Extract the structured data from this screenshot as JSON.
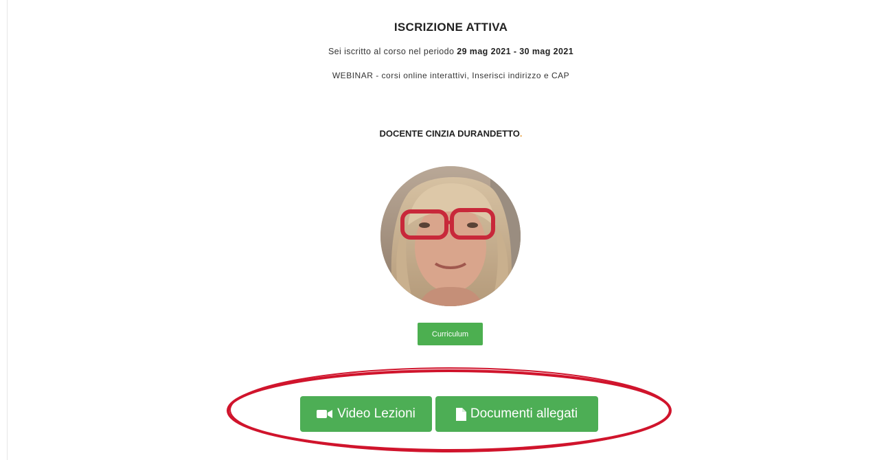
{
  "enrollment": {
    "title": "ISCRIZIONE ATTIVA",
    "period_prefix": "Sei iscritto al corso nel periodo",
    "period_range": "29 mag 2021 - 30 mag 2021",
    "course_type": "WEBINAR - corsi online interattivi, Inserisci indirizzo e CAP"
  },
  "teacher": {
    "label": "DOCENTE CINZIA DURANDETTO",
    "trailing_dot": ".",
    "photo_icon": "teacher-avatar"
  },
  "buttons": {
    "curriculum": "Curriculum",
    "video_lessons": "Video Lezioni",
    "documents": "Documenti allegati"
  },
  "icons": {
    "video": "video-camera-icon",
    "document": "document-file-icon"
  },
  "colors": {
    "button_green": "#4caf50",
    "annotation_red": "#d0142c",
    "accent_dot": "#e8a040"
  }
}
